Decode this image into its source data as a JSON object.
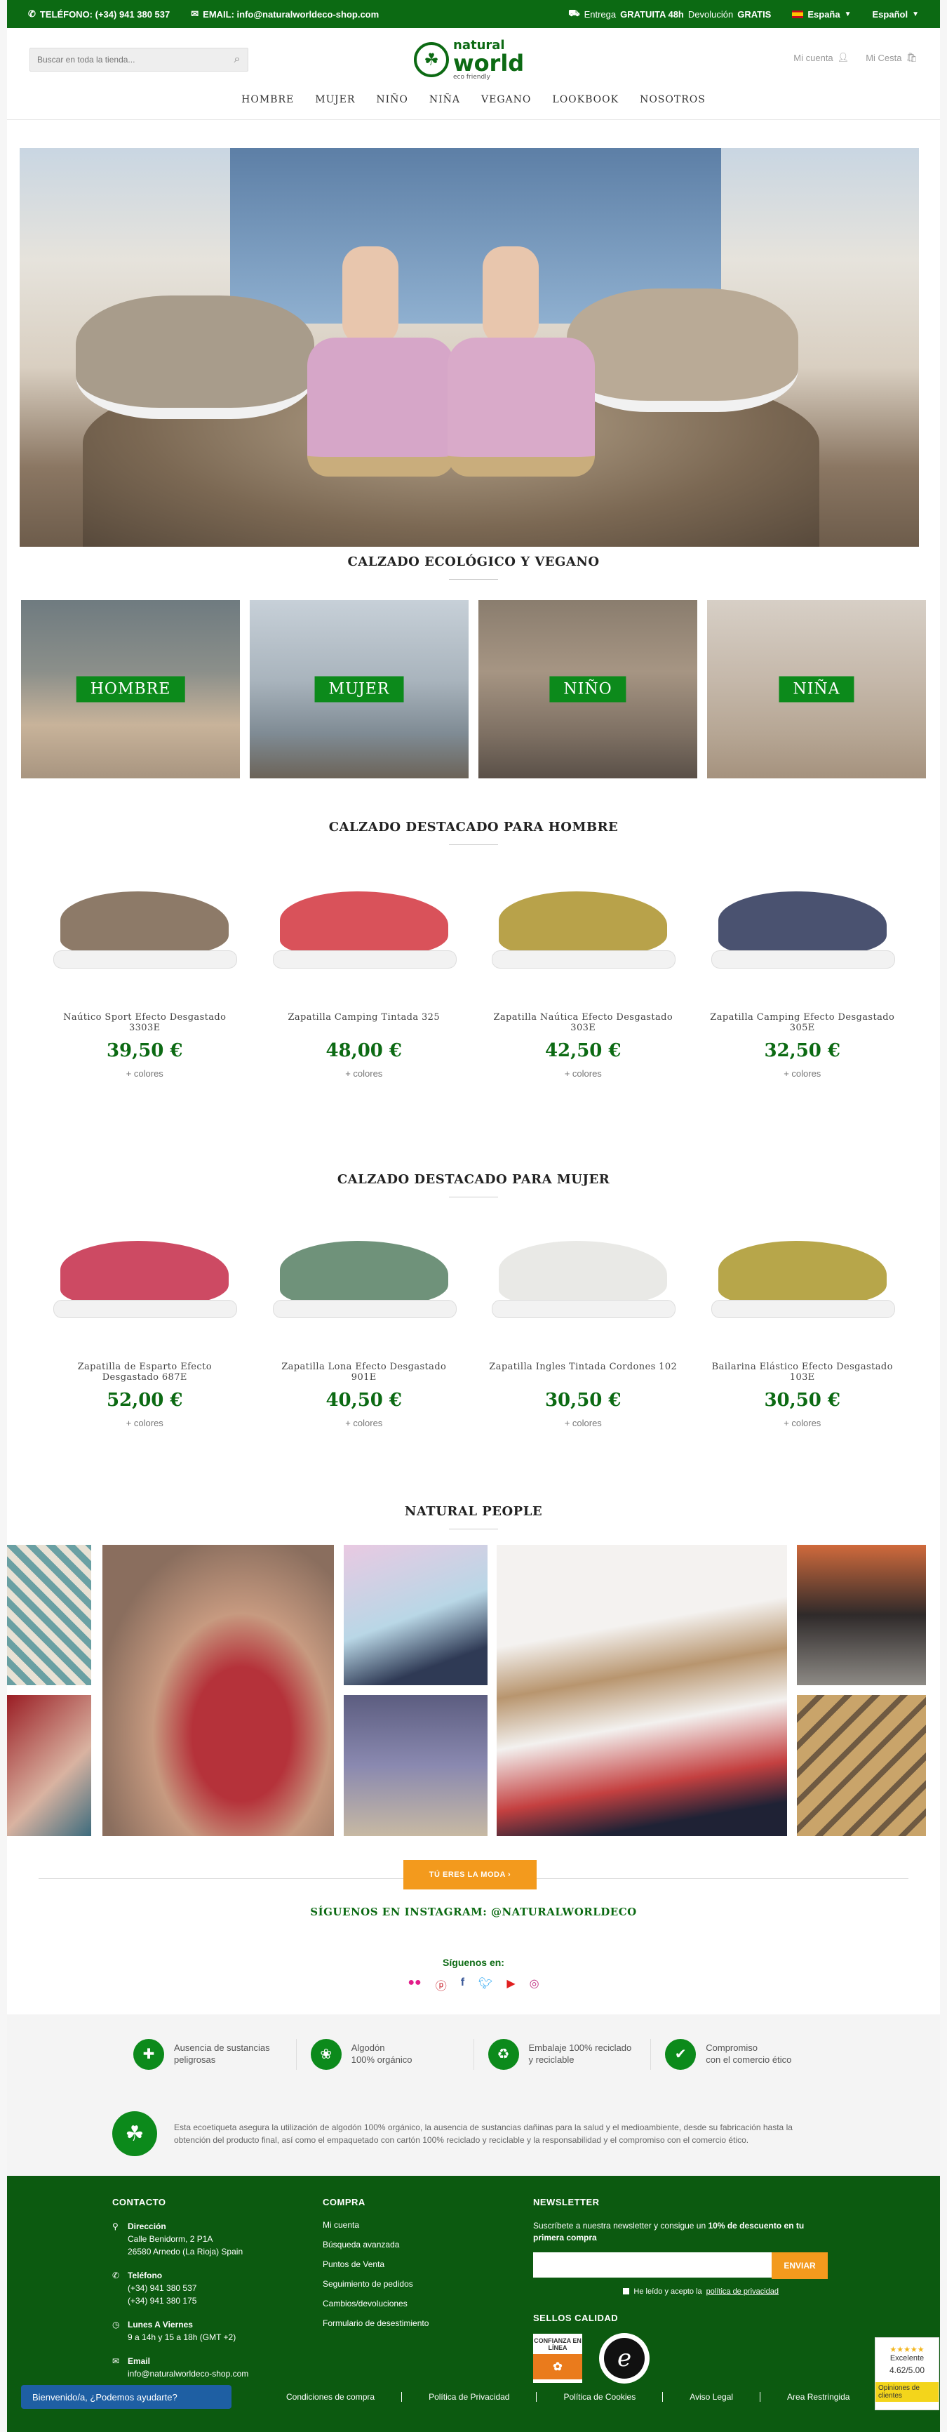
{
  "topbar": {
    "phone": "TELÉFONO: (+34) 941 380 537",
    "email": "EMAIL: info@naturalworldeco-shop.com",
    "shipping_label": "Entrega",
    "shipping_value": "GRATUITA 48h",
    "returns_label": "Devolución",
    "returns_value": "GRATIS",
    "country": "España",
    "language": "Español"
  },
  "header": {
    "search_placeholder": "Buscar en toda la tienda...",
    "logo_top": "natural",
    "logo_main": "world",
    "logo_tag": "eco friendly",
    "account": "Mi cuenta",
    "basket": "Mi Cesta",
    "nav": [
      "HOMBRE",
      "MUJER",
      "NIÑO",
      "NIÑA",
      "VEGANO",
      "LOOKBOOK",
      "NOSOTROS"
    ]
  },
  "sections": {
    "eco": "CALZADO ECOLÓGICO Y VEGANO",
    "men": "CALZADO DESTACADO PARA HOMBRE",
    "women": "CALZADO DESTACADO PARA MUJER",
    "people": "NATURAL PEOPLE"
  },
  "categories": [
    "HOMBRE",
    "MUJER",
    "NIÑO",
    "NIÑA"
  ],
  "men_products": [
    {
      "name": "Naútico Sport Efecto Desgastado 3303E",
      "price": "39,50 €",
      "more": "+ colores",
      "color": "#8d7a68"
    },
    {
      "name": "Zapatilla Camping Tintada 325",
      "price": "48,00 €",
      "more": "+ colores",
      "color": "#d9525a"
    },
    {
      "name": "Zapatilla Naútica Efecto Desgastado 303E",
      "price": "42,50 €",
      "more": "+ colores",
      "color": "#b8a24a"
    },
    {
      "name": "Zapatilla Camping Efecto Desgastado 305E",
      "price": "32,50 €",
      "more": "+ colores",
      "color": "#4a5270"
    }
  ],
  "women_products": [
    {
      "name": "Zapatilla de Esparto Efecto Desgastado 687E",
      "price": "52,00 €",
      "more": "+ colores",
      "color": "#cd4a63"
    },
    {
      "name": "Zapatilla Lona Efecto Desgastado 901E",
      "price": "40,50 €",
      "more": "+ colores",
      "color": "#6f927a"
    },
    {
      "name": "Zapatilla Ingles Tintada Cordones 102",
      "price": "30,50 €",
      "more": "+ colores",
      "color": "#e9e9e6"
    },
    {
      "name": "Bailarina Elástico Efecto Desgastado 103E",
      "price": "30,50 €",
      "more": "+ colores",
      "color": "#b7a64a"
    }
  ],
  "cta": "TÚ ERES LA MODA ›",
  "instagram": "SÍGUENOS EN INSTAGRAM: @NATURALWORLDECO",
  "follow_us": "Síguenos en:",
  "features": [
    {
      "line1": "Ausencia de sustancias",
      "line2": "peligrosas",
      "icon": "✚"
    },
    {
      "line1": "Algodón",
      "line2": "100% orgánico",
      "icon": "❀"
    },
    {
      "line1": "Embalaje 100% reciclado",
      "line2": "y reciclable",
      "icon": "♻"
    },
    {
      "line1": "Compromiso",
      "line2": "con el comercio ético",
      "icon": "✔"
    }
  ],
  "eco_text": "Esta ecoetiqueta asegura la utilización de algodón 100% orgánico, la ausencia de sustancias dañinas para la salud y el medioambiente, desde su fabricación hasta la obtención del producto final, así como el empaquetado con cartón 100% reciclado y reciclable y la responsabilidad y el compromiso con el comercio ético.",
  "footer": {
    "contact_title": "CONTACTO",
    "address_label": "Dirección",
    "address_1": "Calle Benidorm, 2 P1A",
    "address_2": "26580 Arnedo (La Rioja) Spain",
    "phone_label": "Teléfono",
    "phone_1": "(+34) 941 380 537",
    "phone_2": "(+34) 941 380 175",
    "hours_label": "Lunes A Viernes",
    "hours": "9 a 14h y 15 a 18h (GMT +2)",
    "email_label": "Email",
    "email": "info@naturalworldeco-shop.com",
    "buy_title": "COMPRA",
    "buy_links": [
      "Mi cuenta",
      "Búsqueda avanzada",
      "Puntos de Venta",
      "Seguimiento de pedidos",
      "Cambios/devoluciones",
      "Formulario de desestimiento"
    ],
    "news_title": "NEWSLETTER",
    "news_text_1": "Suscríbete a nuestra newsletter y consigue un",
    "news_text_bold": "10% de descuento en tu primera compra",
    "news_button": "ENVIAR",
    "news_check": "He leído y acepto la",
    "news_policy": "política de privacidad",
    "seals_title": "SELLOS CALIDAD",
    "seal1": "CONFIANZA EN LÍNEA"
  },
  "chat": "Bienvenido/a, ¿Podemos ayudarte?",
  "legal_links": [
    "Condiciones de compra",
    "Política de Privacidad",
    "Política de Cookies",
    "Aviso Legal",
    "Area Restringida"
  ],
  "trust": {
    "label": "Excelente",
    "score": "4.62/5.00",
    "opinions": "Opiniones de clientes"
  },
  "colors": {
    "brand_green": "#0c6a13",
    "accent_orange": "#f39a1d"
  }
}
